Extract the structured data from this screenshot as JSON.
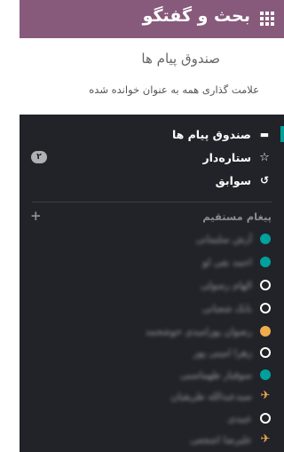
{
  "topbar": {
    "title": "بحث و گفتگو",
    "apps_icon": "apps-grid-icon",
    "background": "#875a7b"
  },
  "breadcrumb": "صندوق پیام ها",
  "toolbar": {
    "mark_all_read": "علامت گذاری همه به عنوان خوانده شده"
  },
  "sidebar": {
    "background": "#212328",
    "accent": "#00a09d",
    "items": [
      {
        "label": "صندوق پیام ها",
        "icon": "inbox-icon"
      },
      {
        "label": "ستاره‌دار",
        "icon": "star-icon",
        "badge": "۲"
      },
      {
        "label": "سوابق",
        "icon": "history-icon"
      }
    ],
    "direct_messages_title": "پیغام مستقیم",
    "add_icon": "plus-icon",
    "direct_messages": [
      {
        "name": "آرش سلیمانی",
        "status": "online"
      },
      {
        "name": "احمد نقی لو",
        "status": "online"
      },
      {
        "name": "الهام رسولی",
        "status": "offline"
      },
      {
        "name": "بابک شعبانی",
        "status": "offline"
      },
      {
        "name": "رضوان پورامیدی خوشحمد",
        "status": "away"
      },
      {
        "name": "زهرا امینی پور",
        "status": "offline"
      },
      {
        "name": "سوفیار طهماسبی",
        "status": "online"
      },
      {
        "name": "سیدعبدالله طریقیان",
        "status": "leave"
      },
      {
        "name": "عبیدی",
        "status": "offline"
      },
      {
        "name": "علیرضا اشجعی",
        "status": "leave"
      }
    ]
  }
}
